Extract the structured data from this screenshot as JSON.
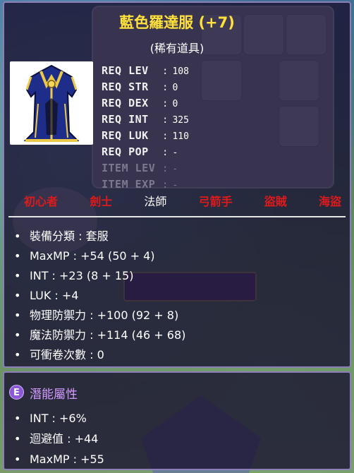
{
  "item": {
    "name": "藍色羅達服 (+7)",
    "rarity": "(稀有道具)",
    "icon": "blue-robe-icon"
  },
  "requirements": [
    {
      "label": "REQ LEV",
      "value": "108",
      "dim": false
    },
    {
      "label": "REQ STR",
      "value": "0",
      "dim": false
    },
    {
      "label": "REQ DEX",
      "value": "0",
      "dim": false
    },
    {
      "label": "REQ INT",
      "value": "325",
      "dim": false
    },
    {
      "label": "REQ LUK",
      "value": "110",
      "dim": false
    },
    {
      "label": "REQ POP",
      "value": "-",
      "dim": false
    },
    {
      "label": "ITEM LEV",
      "value": "-",
      "dim": true
    },
    {
      "label": "ITEM EXP",
      "value": "-",
      "dim": true
    }
  ],
  "jobs": [
    {
      "label": "初心者",
      "active": false
    },
    {
      "label": "劍士",
      "active": false
    },
    {
      "label": "法師",
      "active": true
    },
    {
      "label": "弓箭手",
      "active": false
    },
    {
      "label": "盜賊",
      "active": false
    },
    {
      "label": "海盜",
      "active": false
    }
  ],
  "stats": [
    "裝備分類 : 套服",
    "MaxMP : +54 (50 + 4)",
    "INT : +23 (8 + 15)",
    "LUK : +4",
    "物理防禦力 : +100 (92 + 8)",
    "魔法防禦力 : +114 (46 + 68)",
    "可衝卷次數 : 0"
  ],
  "potential": {
    "badge": "E",
    "title": "潛能屬性",
    "lines": [
      "INT : +6%",
      "迴避值 : +44",
      "MaxMP : +55"
    ]
  },
  "colors": {
    "name": "#ffe03a",
    "job_unavailable": "#e01a1a",
    "potential_title": "#d49bff"
  }
}
